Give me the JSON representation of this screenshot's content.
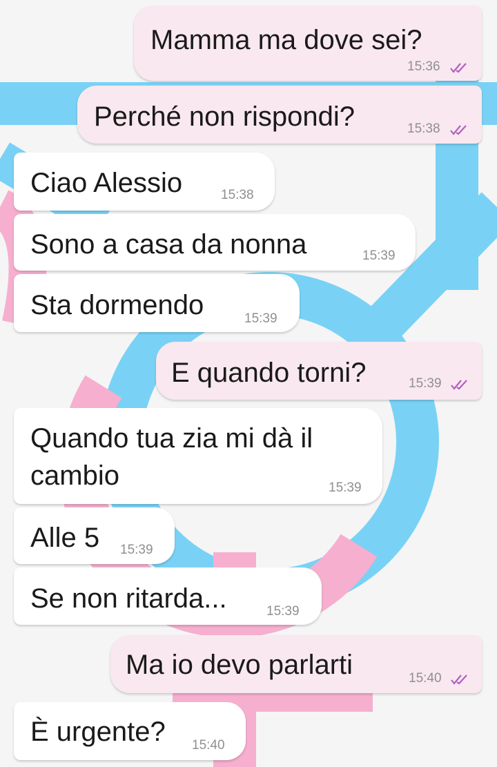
{
  "theme": {
    "outgoing_bubble": "#f9e8ef",
    "incoming_bubble": "#ffffff",
    "read_tick_color": "#b05fc0",
    "wallpaper_blue": "#5cc8f3",
    "wallpaper_pink": "#f59ec5"
  },
  "wallpaper": {
    "icon": "gender-symbols-icon"
  },
  "messages": [
    {
      "direction": "outgoing",
      "text": "Mamma ma dove sei?",
      "time": "15:36",
      "status": "read"
    },
    {
      "direction": "outgoing",
      "text": "Perché non rispondi?",
      "time": "15:38",
      "status": "read"
    },
    {
      "direction": "incoming",
      "text": "Ciao Alessio",
      "time": "15:38"
    },
    {
      "direction": "incoming",
      "text": "Sono a casa da nonna",
      "time": "15:39"
    },
    {
      "direction": "incoming",
      "text": "Sta dormendo",
      "time": "15:39"
    },
    {
      "direction": "outgoing",
      "text": "E quando torni?",
      "time": "15:39",
      "status": "read"
    },
    {
      "direction": "incoming",
      "text_lines": [
        "Quando tua zia mi dà il",
        "cambio"
      ],
      "time": "15:39"
    },
    {
      "direction": "incoming",
      "text": "Alle 5",
      "time": "15:39"
    },
    {
      "direction": "incoming",
      "text": "Se non ritarda...",
      "time": "15:39"
    },
    {
      "direction": "outgoing",
      "text": "Ma io devo parlarti",
      "time": "15:40",
      "status": "read"
    },
    {
      "direction": "incoming",
      "text": "È urgente?",
      "time": "15:40"
    }
  ]
}
